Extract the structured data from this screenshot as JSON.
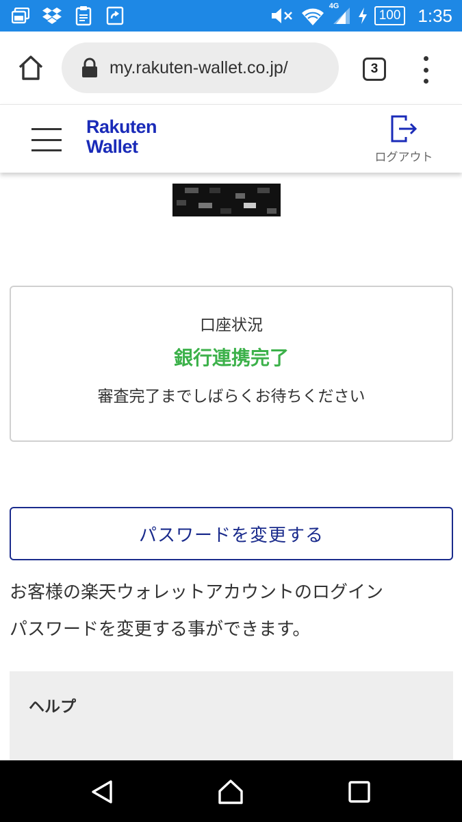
{
  "status_bar": {
    "battery": "100",
    "network": "4G",
    "time": "1:35"
  },
  "browser": {
    "url": "my.rakuten-wallet.co.jp/",
    "tab_count": "3"
  },
  "header": {
    "logo_line1": "Rakuten",
    "logo_line2": "Wallet",
    "logout_label": "ログアウト"
  },
  "account_status": {
    "title": "口座状況",
    "status": "銀行連携完了",
    "note": "審査完了までしばらくお待ちください"
  },
  "password": {
    "button_label": "パスワードを変更する",
    "description_line1": "お客様の楽天ウォレットアカウントのログイン",
    "description_line2": "パスワードを変更する事ができます。"
  },
  "help": {
    "title": "ヘルプ"
  },
  "colors": {
    "status_bar": "#1e88e5",
    "brand_blue": "#1a2bb8",
    "status_green": "#3cb14a",
    "button_border": "#1a2b8c"
  }
}
